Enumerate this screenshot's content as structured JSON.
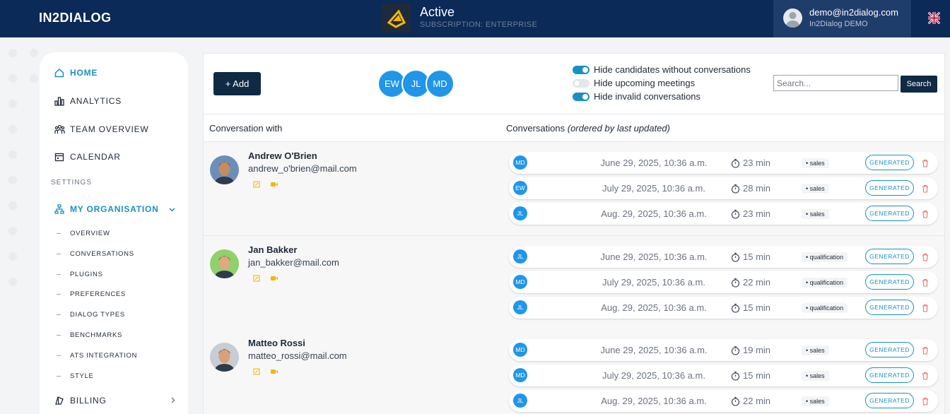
{
  "header": {
    "brand": "IN2DIALOG",
    "status_title": "Active",
    "subscription": "SUBSCRIPTION: ENTERPRISE",
    "user_email": "demo@in2dialog.com",
    "user_org": "In2Dialog DEMO",
    "language_flag": "uk-flag-icon"
  },
  "sidebar": {
    "items": [
      {
        "label": "HOME",
        "icon": "home-icon"
      },
      {
        "label": "ANALYTICS",
        "icon": "chart-icon"
      },
      {
        "label": "TEAM OVERVIEW",
        "icon": "team-icon"
      },
      {
        "label": "CALENDAR",
        "icon": "calendar-icon"
      }
    ],
    "settings_label": "SETTINGS",
    "org": {
      "label": "MY ORGANISATION",
      "icon": "organisation-icon"
    },
    "sub_items": [
      "OVERVIEW",
      "CONVERSATIONS",
      "PLUGINS",
      "PREFERENCES",
      "DIALOG TYPES",
      "BENCHMARKS",
      "ATS INTEGRATION",
      "STYLE"
    ],
    "billing": {
      "label": "BILLING",
      "icon": "billing-icon"
    }
  },
  "toolbar": {
    "add_label": "+ Add",
    "members": [
      "EW",
      "JL",
      "MD"
    ],
    "filters": [
      {
        "label": "Hide candidates without conversations",
        "on": true
      },
      {
        "label": "Hide upcoming meetings",
        "on": false
      },
      {
        "label": "Hide invalid conversations",
        "on": true
      }
    ],
    "search_placeholder": "Search...",
    "search_label": "Search"
  },
  "table": {
    "col_with": "Conversation with",
    "col_conv": "Conversations",
    "col_conv_note": "(ordered by last updated)",
    "generated_label": "GENERATED"
  },
  "candidates": [
    {
      "name": "Andrew O'Brien",
      "email": "andrew_o'brien@mail.com",
      "conversations": [
        {
          "ini": "MD",
          "date": "June 29, 2025, 10:36 a.m.",
          "dur": "23 min",
          "tag": "• sales"
        },
        {
          "ini": "EW",
          "date": "July 29, 2025, 10:36 a.m.",
          "dur": "28 min",
          "tag": "• sales"
        },
        {
          "ini": "JL",
          "date": "Aug. 29, 2025, 10:36 a.m.",
          "dur": "23 min",
          "tag": "• sales"
        }
      ]
    },
    {
      "name": "Jan Bakker",
      "email": "jan_bakker@mail.com",
      "conversations": [
        {
          "ini": "JL",
          "date": "June 29, 2025, 10:36 a.m.",
          "dur": "15 min",
          "tag": "• qualification"
        },
        {
          "ini": "MD",
          "date": "July 29, 2025, 10:36 a.m.",
          "dur": "22 min",
          "tag": "• qualification"
        },
        {
          "ini": "JL",
          "date": "Aug. 29, 2025, 10:36 a.m.",
          "dur": "15 min",
          "tag": "• qualification"
        }
      ]
    },
    {
      "name": "Matteo Rossi",
      "email": "matteo_rossi@mail.com",
      "conversations": [
        {
          "ini": "MD",
          "date": "June 29, 2025, 10:36 a.m.",
          "dur": "19 min",
          "tag": "• sales"
        },
        {
          "ini": "MD",
          "date": "July 29, 2025, 10:36 a.m.",
          "dur": "15 min",
          "tag": "• sales"
        },
        {
          "ini": "JL",
          "date": "Aug. 29, 2025, 10:36 a.m.",
          "dur": "22 min",
          "tag": "• sales"
        }
      ]
    }
  ],
  "colors": {
    "navy": "#0b2a57",
    "accent": "#1a8fc4",
    "circle": "#2196e8"
  }
}
